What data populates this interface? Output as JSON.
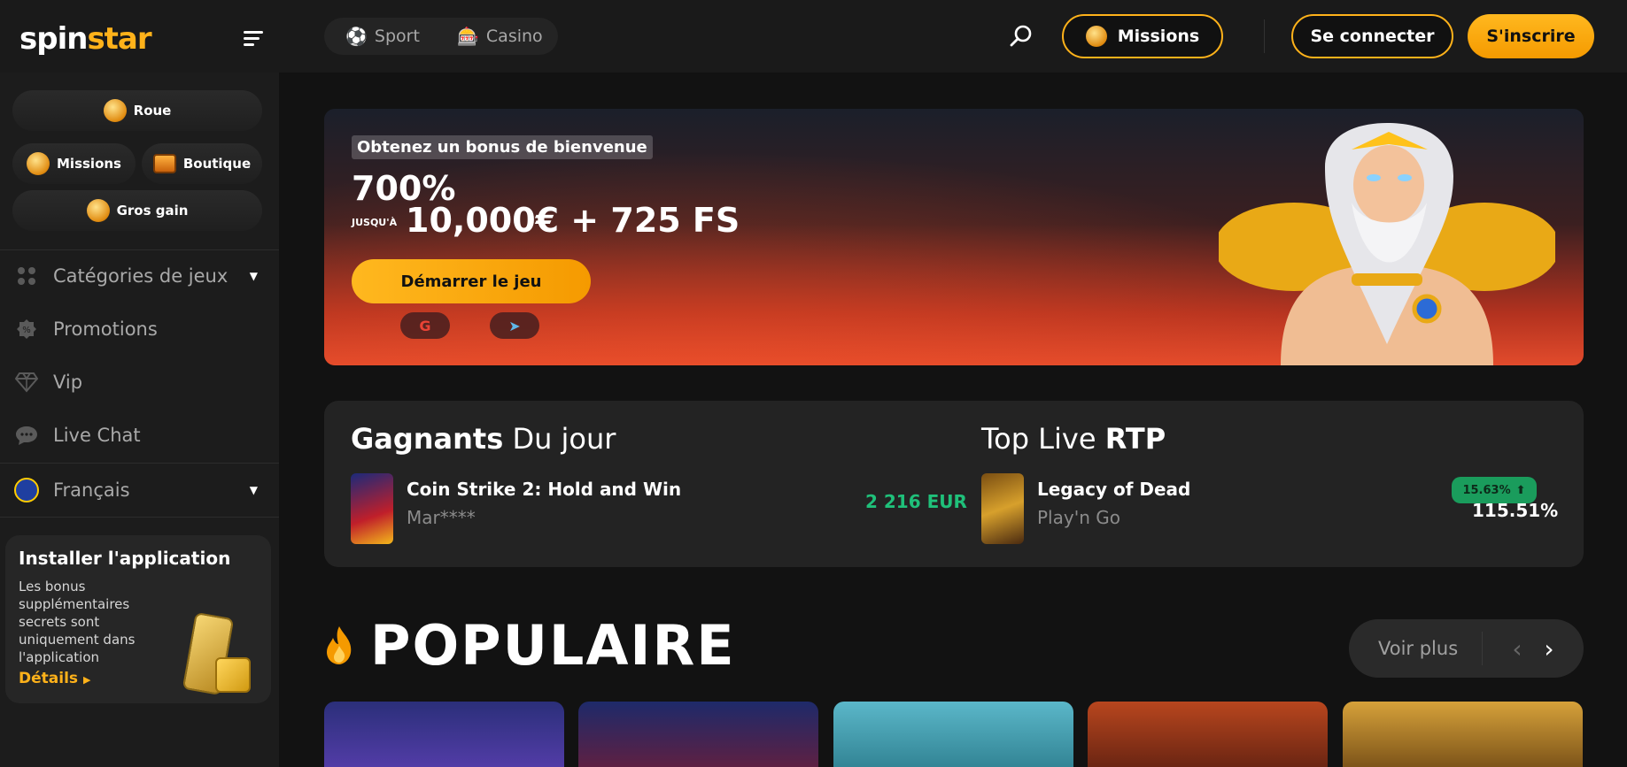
{
  "header": {
    "logo_part1": "spin",
    "logo_part2": "star",
    "nav": [
      {
        "label": "Sport",
        "icon": "soccer-ball-icon"
      },
      {
        "label": "Casino",
        "icon": "slot-machine-icon"
      }
    ],
    "missions_label": "Missions",
    "login_label": "Se connecter",
    "register_label": "S'inscrire"
  },
  "sidebar": {
    "quick_buttons": {
      "wheel": "Roue",
      "missions": "Missions",
      "shop": "Boutique",
      "jackpot": "Gros gain"
    },
    "links": [
      {
        "label": "Catégories de jeux",
        "icon": "grid-dots-icon"
      },
      {
        "label": "Promotions",
        "icon": "promo-badge-icon"
      },
      {
        "label": "Vip",
        "icon": "diamond-icon"
      },
      {
        "label": "Live Chat",
        "icon": "chat-bubble-icon"
      }
    ],
    "language": "Français",
    "install": {
      "title": "Installer l'application",
      "text": "Les bonus supplémentaires secrets sont uniquement dans l'application",
      "link": "Détails"
    }
  },
  "banner": {
    "tag": "Obtenez un bonus de bienvenue",
    "line1": "700%",
    "up_to": "JUSQU'À",
    "line2": "10,000€ + 725 FS",
    "cta": "Démarrer le jeu",
    "social": [
      {
        "label": "G",
        "icon": "google-icon"
      },
      {
        "label": "➤",
        "icon": "telegram-icon"
      }
    ]
  },
  "winners": {
    "title_bold": "Gagnants",
    "title_rest": "Du jour",
    "game": "Coin Strike 2: Hold and Win",
    "player": "Mar****",
    "amount": "2 216 EUR"
  },
  "top_rtp": {
    "title_rest": "Top Live",
    "title_bold": "RTP",
    "game": "Legacy of Dead",
    "provider": "Play'n Go",
    "badge": "15.63%",
    "rtp": "115.51%"
  },
  "popular": {
    "title": "POPULAIRE",
    "see_more": "Voir plus"
  },
  "colors": {
    "accent": "#ffb21a",
    "green": "#1fc07a",
    "background": "#121212"
  }
}
